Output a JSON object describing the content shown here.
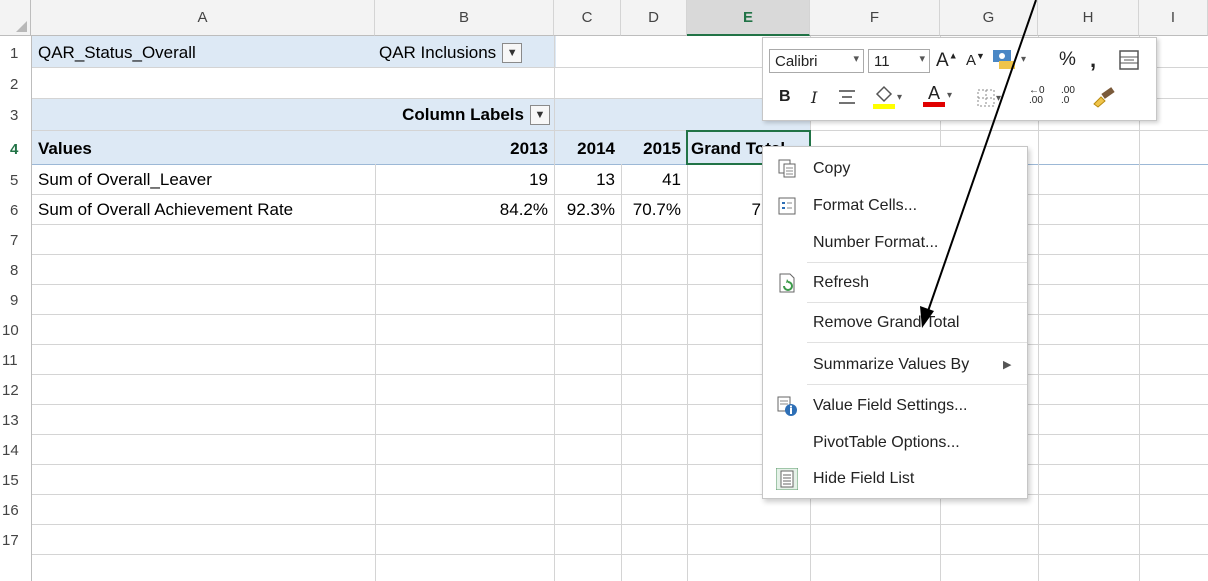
{
  "columns": [
    "A",
    "B",
    "C",
    "D",
    "E",
    "F",
    "G",
    "H",
    "I"
  ],
  "selected_column": "E",
  "rows": [
    "1",
    "2",
    "3",
    "4",
    "5",
    "6",
    "7",
    "8",
    "9",
    "10",
    "11",
    "12",
    "13",
    "14",
    "15",
    "16",
    "17"
  ],
  "selected_row": "4",
  "cells": {
    "a1": "QAR_Status_Overall",
    "b1": "QAR Inclusions",
    "b3": "Column Labels",
    "a4": "Values",
    "b4": "2013",
    "c4": "2014",
    "d4": "2015",
    "e4": "Grand Total",
    "a5": "Sum of Overall_Leaver",
    "b5": "19",
    "c5": "13",
    "d5": "41",
    "a6": "Sum of Overall Achievement Rate",
    "b6": "84.2%",
    "c6": "92.3%",
    "d6": "70.7%",
    "e6": "7"
  },
  "mini_toolbar": {
    "font_name": "Calibri",
    "font_size": "11",
    "bold": "B",
    "italic": "I",
    "percent": "%",
    "comma": ",",
    "font_color_letter": "A",
    "increase_decimal": ".00",
    "decrease_decimal": ".0"
  },
  "context_menu": {
    "copy": "Copy",
    "format_cells": "Format Cells...",
    "number_format": "Number Format...",
    "refresh": "Refresh",
    "remove_grand_total": "Remove Grand Total",
    "summarize_values_by": "Summarize Values By",
    "value_field_settings": "Value Field Settings...",
    "pivottable_options": "PivotTable Options...",
    "hide_field_list": "Hide Field List"
  },
  "colors": {
    "pivot_fill": "#dde9f5",
    "selection_green": "#217346",
    "arrow": "#000000"
  }
}
